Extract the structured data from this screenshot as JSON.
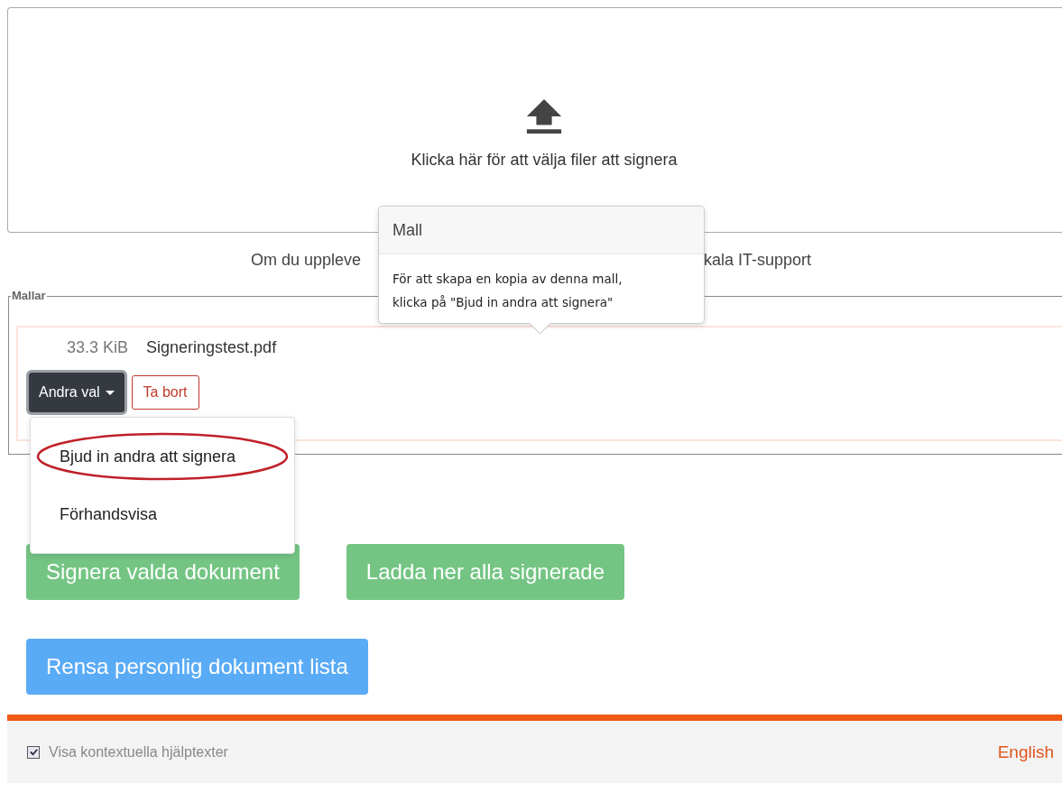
{
  "upload": {
    "text": "Klicka här för att välja filer att signera"
  },
  "notice": {
    "fragments": [
      "Om du uppleve",
      "kala IT-support"
    ]
  },
  "popover": {
    "title": "Mall",
    "lines": [
      "För att skapa en kopia av denna mall,",
      "klicka på \"Bjud in andra att signera\""
    ]
  },
  "templates": {
    "legend": "Mallar",
    "files": [
      {
        "size": "33.3 KiB",
        "name": "Signeringstest.pdf",
        "actions": [
          {
            "label": "Andra val",
            "kind": "dropdown",
            "expanded": true
          },
          {
            "label": "Ta bort",
            "kind": "danger"
          }
        ]
      }
    ]
  },
  "dropdown_menu": {
    "items": [
      {
        "label": "Bjud in andra att signera",
        "highlighted": true
      },
      {
        "label": "Förhandsvisa",
        "highlighted": false
      }
    ]
  },
  "actions": [
    {
      "label": "Signera valda dokument",
      "kind": "success"
    },
    {
      "label": "Ladda ner alla signerade",
      "kind": "success"
    },
    {
      "label": "Rensa personlig dokument lista",
      "kind": "primary"
    }
  ],
  "footer": {
    "help_toggle": {
      "label": "Visa kontextuella hjälptexter",
      "checked": true
    },
    "language_link": "English"
  }
}
